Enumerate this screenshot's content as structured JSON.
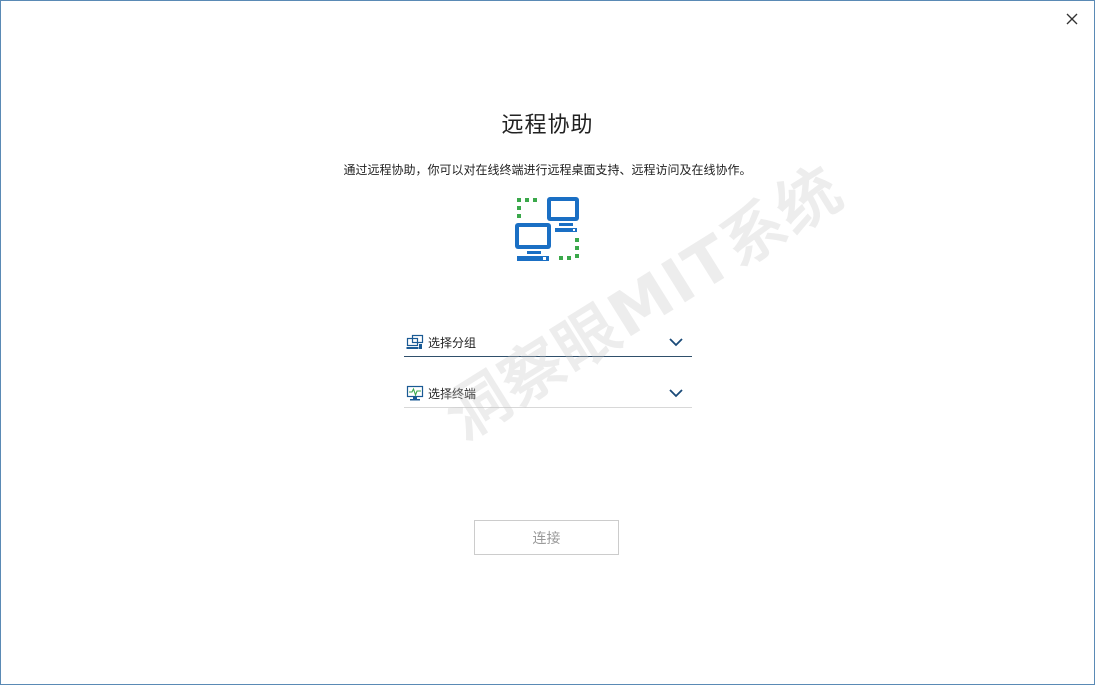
{
  "window": {
    "close_label": "×"
  },
  "page": {
    "title": "远程协助",
    "description": "通过远程协助，你可以对在线终端进行远程桌面支持、远程访问及在线协作。"
  },
  "form": {
    "group_select": {
      "label": "选择分组",
      "icon": "group-icon"
    },
    "terminal_select": {
      "label": "选择终端",
      "icon": "terminal-icon"
    },
    "connect_label": "连接"
  },
  "watermark": {
    "text": "洞察眼MIT系统"
  },
  "colors": {
    "accent_blue": "#1a6fc4",
    "dotted_green": "#3aa84a",
    "border_dark": "#2f4f6b",
    "disabled_text": "#9a9a9a"
  }
}
